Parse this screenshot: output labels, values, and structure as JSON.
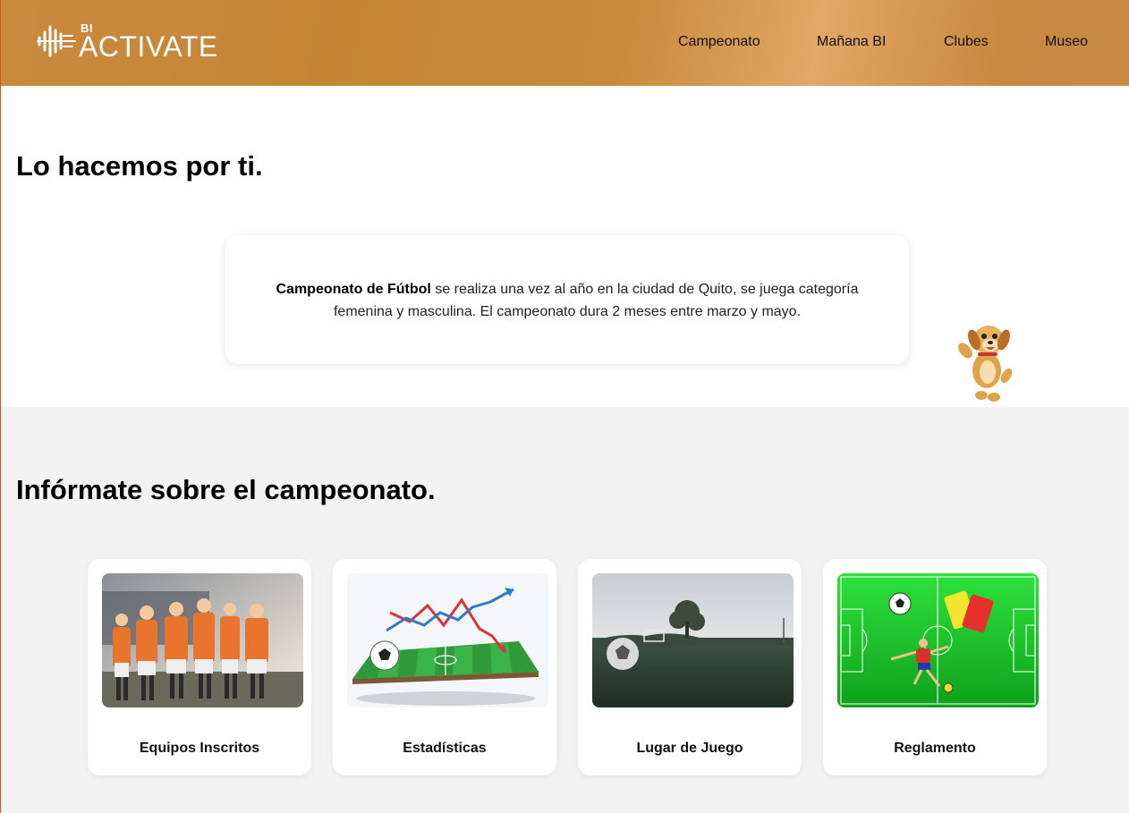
{
  "header": {
    "logo_super": "BI",
    "logo_text": "ACTIVATE",
    "nav": [
      "Campeonato",
      "Mañana BI",
      "Clubes",
      "Museo"
    ]
  },
  "hero": {
    "title": "Lo hacemos por ti.",
    "info_bold": "Campeonato de Fútbol",
    "info_text": " se realiza una vez al año en la ciudad de Quito, se juega categoría femenina y masculina. El campeonato dura 2 meses entre marzo y mayo."
  },
  "info_section": {
    "title": "Infórmate sobre el campeonato.",
    "cards": [
      {
        "label": "Equipos Inscritos",
        "icon": "team-photo"
      },
      {
        "label": "Estadísticas",
        "icon": "stats-chart-image"
      },
      {
        "label": "Lugar de Juego",
        "icon": "field-photo"
      },
      {
        "label": "Reglamento",
        "icon": "rules-illustration"
      }
    ]
  },
  "colors": {
    "header_bg": "#c88a3c",
    "section_bg": "#f3f3f3",
    "card_bg": "#ffffff"
  }
}
